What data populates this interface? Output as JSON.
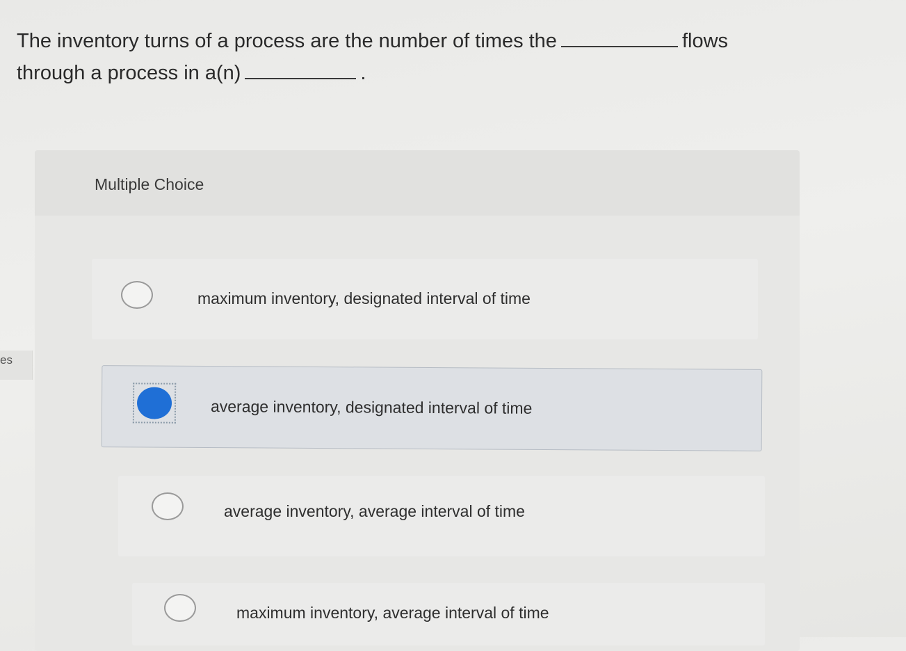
{
  "question": {
    "line1_text": "The inventory turns of a process are the number of times the",
    "line1_end": "flows",
    "line2_text": "through a process in a(n)",
    "line2_end": "."
  },
  "sidebar": {
    "fragment_text": "es"
  },
  "multiple_choice": {
    "title": "Multiple Choice",
    "options": [
      {
        "label": "maximum inventory, designated interval of time",
        "selected": false
      },
      {
        "label": "average inventory, designated interval of time",
        "selected": true
      },
      {
        "label": "average inventory, average interval of time",
        "selected": false
      },
      {
        "label": "maximum inventory, average interval of time",
        "selected": false
      }
    ]
  },
  "colors": {
    "selected_radio": "#1f6fd6",
    "selected_option_bg": "#dde0e4"
  }
}
